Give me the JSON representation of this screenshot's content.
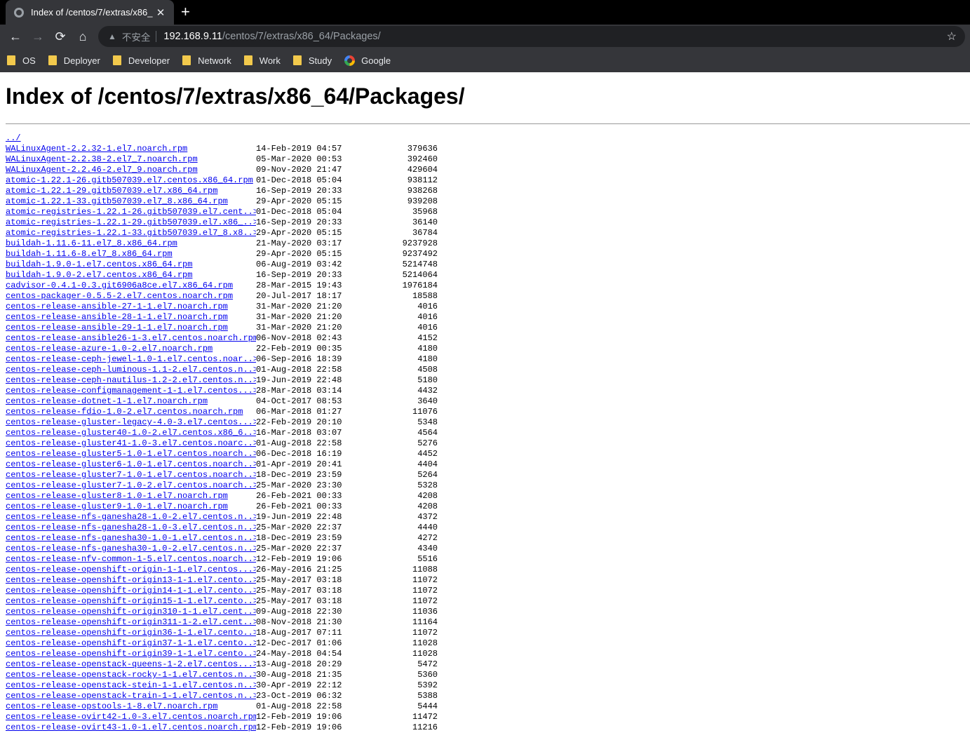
{
  "tab": {
    "title": "Index of /centos/7/extras/x86_",
    "close": "✕",
    "new_tab": "+"
  },
  "toolbar": {
    "back": "←",
    "forward": "→",
    "reload": "⟳",
    "home": "⌂",
    "warning": "▲",
    "insecure": "不安全",
    "host": "192.168.9.11",
    "path": "/centos/7/extras/x86_64/Packages/",
    "bookmark_star": "☆"
  },
  "bookmarks": [
    "OS",
    "Deployer",
    "Developer",
    "Network",
    "Work",
    "Study",
    "Google"
  ],
  "page": {
    "heading": "Index of /centos/7/extras/x86_64/Packages/",
    "parent": "../"
  },
  "files": [
    [
      "WALinuxAgent-2.2.32-1.el7.noarch.rpm",
      "14-Feb-2019 04:57",
      "379636"
    ],
    [
      "WALinuxAgent-2.2.38-2.el7_7.noarch.rpm",
      "05-Mar-2020 00:53",
      "392460"
    ],
    [
      "WALinuxAgent-2.2.46-2.el7_9.noarch.rpm",
      "09-Nov-2020 21:47",
      "429604"
    ],
    [
      "atomic-1.22.1-26.gitb507039.el7.centos.x86_64.rpm",
      "01-Dec-2018 05:04",
      "938112"
    ],
    [
      "atomic-1.22.1-29.gitb507039.el7.x86_64.rpm",
      "16-Sep-2019 20:33",
      "938268"
    ],
    [
      "atomic-1.22.1-33.gitb507039.el7_8.x86_64.rpm",
      "29-Apr-2020 05:15",
      "939208"
    ],
    [
      "atomic-registries-1.22.1-26.gitb507039.el7.cent..>",
      "01-Dec-2018 05:04",
      "35968"
    ],
    [
      "atomic-registries-1.22.1-29.gitb507039.el7.x86_..>",
      "16-Sep-2019 20:33",
      "36140"
    ],
    [
      "atomic-registries-1.22.1-33.gitb507039.el7_8.x8..>",
      "29-Apr-2020 05:15",
      "36784"
    ],
    [
      "buildah-1.11.6-11.el7_8.x86_64.rpm",
      "21-May-2020 03:17",
      "9237928"
    ],
    [
      "buildah-1.11.6-8.el7_8.x86_64.rpm",
      "29-Apr-2020 05:15",
      "9237492"
    ],
    [
      "buildah-1.9.0-1.el7.centos.x86_64.rpm",
      "06-Aug-2019 03:42",
      "5214748"
    ],
    [
      "buildah-1.9.0-2.el7.centos.x86_64.rpm",
      "16-Sep-2019 20:33",
      "5214064"
    ],
    [
      "cadvisor-0.4.1-0.3.git6906a8ce.el7.x86_64.rpm",
      "28-Mar-2015 19:43",
      "1976184"
    ],
    [
      "centos-packager-0.5.5-2.el7.centos.noarch.rpm",
      "20-Jul-2017 18:17",
      "18588"
    ],
    [
      "centos-release-ansible-27-1-1.el7.noarch.rpm",
      "31-Mar-2020 21:20",
      "4016"
    ],
    [
      "centos-release-ansible-28-1-1.el7.noarch.rpm",
      "31-Mar-2020 21:20",
      "4016"
    ],
    [
      "centos-release-ansible-29-1-1.el7.noarch.rpm",
      "31-Mar-2020 21:20",
      "4016"
    ],
    [
      "centos-release-ansible26-1-3.el7.centos.noarch.rpm",
      "06-Nov-2018 02:43",
      "4152"
    ],
    [
      "centos-release-azure-1.0-2.el7.noarch.rpm",
      "22-Feb-2019 00:35",
      "4180"
    ],
    [
      "centos-release-ceph-jewel-1.0-1.el7.centos.noar..>",
      "06-Sep-2016 18:39",
      "4180"
    ],
    [
      "centos-release-ceph-luminous-1.1-2.el7.centos.n..>",
      "01-Aug-2018 22:58",
      "4508"
    ],
    [
      "centos-release-ceph-nautilus-1.2-2.el7.centos.n..>",
      "19-Jun-2019 22:48",
      "5180"
    ],
    [
      "centos-release-configmanagement-1-1.el7.centos...>",
      "28-Mar-2018 03:14",
      "4432"
    ],
    [
      "centos-release-dotnet-1-1.el7.noarch.rpm",
      "04-Oct-2017 08:53",
      "3640"
    ],
    [
      "centos-release-fdio-1.0-2.el7.centos.noarch.rpm",
      "06-Mar-2018 01:27",
      "11076"
    ],
    [
      "centos-release-gluster-legacy-4.0-3.el7.centos...>",
      "22-Feb-2019 20:10",
      "5348"
    ],
    [
      "centos-release-gluster40-1.0-2.el7.centos.x86_6..>",
      "16-Mar-2018 03:07",
      "4564"
    ],
    [
      "centos-release-gluster41-1.0-3.el7.centos.noarc..>",
      "01-Aug-2018 22:58",
      "5276"
    ],
    [
      "centos-release-gluster5-1.0-1.el7.centos.noarch..>",
      "06-Dec-2018 16:19",
      "4452"
    ],
    [
      "centos-release-gluster6-1.0-1.el7.centos.noarch..>",
      "01-Apr-2019 20:41",
      "4404"
    ],
    [
      "centos-release-gluster7-1.0-1.el7.centos.noarch..>",
      "18-Dec-2019 23:59",
      "5264"
    ],
    [
      "centos-release-gluster7-1.0-2.el7.centos.noarch..>",
      "25-Mar-2020 23:30",
      "5328"
    ],
    [
      "centos-release-gluster8-1.0-1.el7.noarch.rpm",
      "26-Feb-2021 00:33",
      "4208"
    ],
    [
      "centos-release-gluster9-1.0-1.el7.noarch.rpm",
      "26-Feb-2021 00:33",
      "4208"
    ],
    [
      "centos-release-nfs-ganesha28-1.0-2.el7.centos.n..>",
      "19-Jun-2019 22:48",
      "4372"
    ],
    [
      "centos-release-nfs-ganesha28-1.0-3.el7.centos.n..>",
      "25-Mar-2020 22:37",
      "4440"
    ],
    [
      "centos-release-nfs-ganesha30-1.0-1.el7.centos.n..>",
      "18-Dec-2019 23:59",
      "4272"
    ],
    [
      "centos-release-nfs-ganesha30-1.0-2.el7.centos.n..>",
      "25-Mar-2020 22:37",
      "4340"
    ],
    [
      "centos-release-nfv-common-1-5.el7.centos.noarch..>",
      "12-Feb-2019 19:06",
      "5516"
    ],
    [
      "centos-release-openshift-origin-1-1.el7.centos...>",
      "26-May-2016 21:25",
      "11088"
    ],
    [
      "centos-release-openshift-origin13-1-1.el7.cento..>",
      "25-May-2017 03:18",
      "11072"
    ],
    [
      "centos-release-openshift-origin14-1-1.el7.cento..>",
      "25-May-2017 03:18",
      "11072"
    ],
    [
      "centos-release-openshift-origin15-1-1.el7.cento..>",
      "25-May-2017 03:18",
      "11072"
    ],
    [
      "centos-release-openshift-origin310-1-1.el7.cent..>",
      "09-Aug-2018 22:30",
      "11036"
    ],
    [
      "centos-release-openshift-origin311-1-2.el7.cent..>",
      "08-Nov-2018 21:30",
      "11164"
    ],
    [
      "centos-release-openshift-origin36-1-1.el7.cento..>",
      "18-Aug-2017 07:11",
      "11072"
    ],
    [
      "centos-release-openshift-origin37-1-1.el7.cento..>",
      "12-Dec-2017 01:06",
      "11028"
    ],
    [
      "centos-release-openshift-origin39-1-1.el7.cento..>",
      "24-May-2018 04:54",
      "11028"
    ],
    [
      "centos-release-openstack-queens-1-2.el7.centos...>",
      "13-Aug-2018 20:29",
      "5472"
    ],
    [
      "centos-release-openstack-rocky-1-1.el7.centos.n..>",
      "30-Aug-2018 21:35",
      "5360"
    ],
    [
      "centos-release-openstack-stein-1-1.el7.centos.n..>",
      "30-Apr-2019 22:12",
      "5392"
    ],
    [
      "centos-release-openstack-train-1-1.el7.centos.n..>",
      "23-Oct-2019 06:32",
      "5388"
    ],
    [
      "centos-release-opstools-1-8.el7.noarch.rpm",
      "01-Aug-2018 22:58",
      "5444"
    ],
    [
      "centos-release-ovirt42-1.0-3.el7.centos.noarch.rpm",
      "12-Feb-2019 19:06",
      "11472"
    ],
    [
      "centos-release-ovirt43-1.0-1.el7.centos.noarch.rpm",
      "12-Feb-2019 19:06",
      "11216"
    ]
  ]
}
